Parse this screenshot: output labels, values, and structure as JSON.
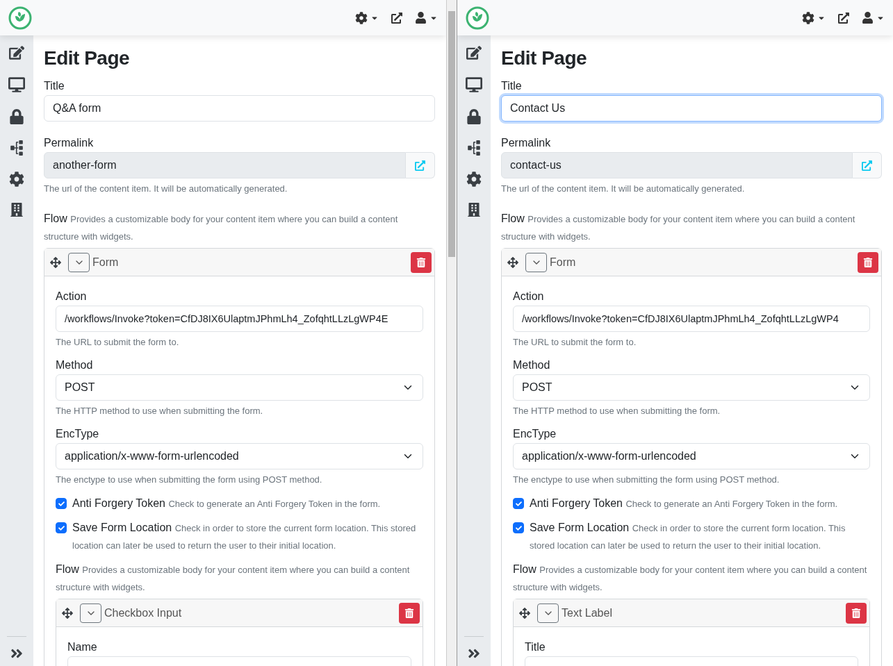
{
  "panes": [
    {
      "heading": "Edit Page",
      "title_label": "Title",
      "title_value": "Q&A form",
      "title_focused": false,
      "permalink_label": "Permalink",
      "permalink_value": "another-form",
      "permalink_hint": "The url of the content item. It will be automatically generated.",
      "flow_label": "Flow",
      "flow_hint": "Provides a customizable body for your content item where you can build a content structure with widgets.",
      "widget": {
        "title": "Form",
        "fields": [
          {
            "kind": "text",
            "label": "Action",
            "value": "/workflows/Invoke?token=CfDJ8IX6UlaptmJPhmLh4_ZofqhtLLzLgWP4E",
            "hint": "The URL to submit the form to."
          },
          {
            "kind": "select",
            "label": "Method",
            "value": "POST",
            "hint": "The HTTP method to use when submitting the form."
          },
          {
            "kind": "select",
            "label": "EncType",
            "value": "application/x-www-form-urlencoded",
            "hint": "The enctype to use when submitting the form using POST method."
          },
          {
            "kind": "checkbox",
            "label": "Anti Forgery Token",
            "checked": true,
            "hint": "Check to generate an Anti Forgery Token in the form."
          },
          {
            "kind": "checkbox",
            "label": "Save Form Location",
            "checked": true,
            "hint": "Check in order to store the current form location. This stored location can later be used to return the user to their initial location."
          },
          {
            "kind": "flow",
            "label": "Flow",
            "hint": "Provides a customizable body for your content item where you can build a content structure with widgets.",
            "child": {
              "title": "Checkbox Input",
              "field_label": "Name"
            }
          }
        ]
      }
    },
    {
      "heading": "Edit Page",
      "title_label": "Title",
      "title_value": "Contact Us",
      "title_focused": true,
      "permalink_label": "Permalink",
      "permalink_value": "contact-us",
      "permalink_hint": "The url of the content item. It will be automatically generated.",
      "flow_label": "Flow",
      "flow_hint": "Provides a customizable body for your content item where you can build a content structure with widgets.",
      "widget": {
        "title": "Form",
        "fields": [
          {
            "kind": "text",
            "label": "Action",
            "value": "/workflows/Invoke?token=CfDJ8IX6UlaptmJPhmLh4_ZofqhtLLzLgWP4",
            "hint": "The URL to submit the form to."
          },
          {
            "kind": "select",
            "label": "Method",
            "value": "POST",
            "hint": "The HTTP method to use when submitting the form."
          },
          {
            "kind": "select",
            "label": "EncType",
            "value": "application/x-www-form-urlencoded",
            "hint": "The enctype to use when submitting the form using POST method."
          },
          {
            "kind": "checkbox",
            "label": "Anti Forgery Token",
            "checked": true,
            "hint": "Check to generate an Anti Forgery Token in the form."
          },
          {
            "kind": "checkbox",
            "label": "Save Form Location",
            "checked": true,
            "hint": "Check in order to store the current form location. This stored location can later be used to return the user to their initial location."
          },
          {
            "kind": "flow",
            "label": "Flow",
            "hint": "Provides a customizable body for your content item where you can build a content structure with widgets.",
            "child": {
              "title": "Text Label",
              "field_label": "Title"
            }
          }
        ]
      }
    }
  ]
}
